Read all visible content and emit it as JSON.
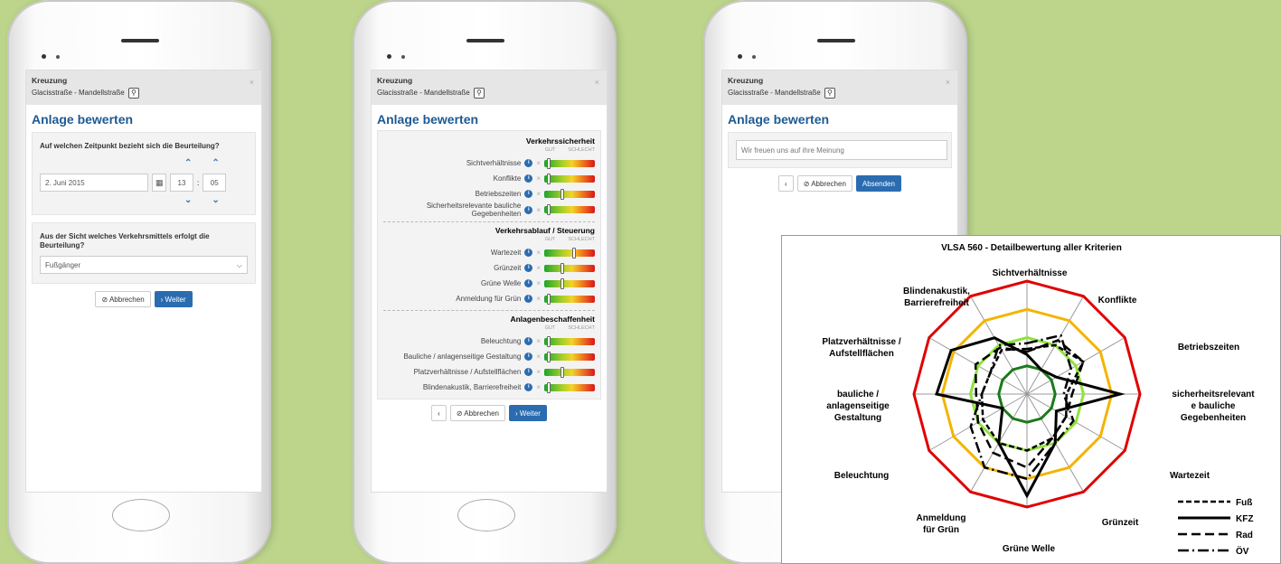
{
  "header": {
    "title": "Kreuzung",
    "address": "Glacisstraße - Mandellstraße",
    "close": "×",
    "pin": "⚲"
  },
  "page_title": "Anlage bewerten",
  "phone1": {
    "question1": "Auf welchen Zeitpunkt bezieht sich die Beurteilung?",
    "date": "2. Juni 2015",
    "hour": "13",
    "minute": "05",
    "question2": "Aus der Sicht welches Verkehrsmittels erfolgt die Beurteilung?",
    "mode": "Fußgänger",
    "cancel": "Abbrechen",
    "next": "Weiter"
  },
  "phone2": {
    "good": "GUT",
    "bad": "SCHLECHT",
    "sections": [
      {
        "title": "Verkehrssicherheit",
        "items": [
          {
            "label": "Sichtverhältnisse",
            "value": 0.05
          },
          {
            "label": "Konflikte",
            "value": 0.05
          },
          {
            "label": "Betriebszeiten",
            "value": 0.35
          },
          {
            "label": "Sicherheitsrelevante bauliche Gegebenheiten",
            "value": 0.05
          }
        ]
      },
      {
        "title": "Verkehrsablauf / Steuerung",
        "items": [
          {
            "label": "Wartezeit",
            "value": 0.6
          },
          {
            "label": "Grünzeit",
            "value": 0.35
          },
          {
            "label": "Grüne Welle",
            "value": 0.35
          },
          {
            "label": "Anmeldung für Grün",
            "value": 0.05
          }
        ]
      },
      {
        "title": "Anlagenbeschaffenheit",
        "items": [
          {
            "label": "Beleuchtung",
            "value": 0.05
          },
          {
            "label": "Bauliche / anlagenseitige Gestaltung",
            "value": 0.05
          },
          {
            "label": "Platzverhältnisse / Aufstellflächen",
            "value": 0.35
          },
          {
            "label": "Blindenakustik, Barrierefreiheit",
            "value": 0.05
          }
        ]
      }
    ],
    "cancel": "Abbrechen",
    "next": "Weiter"
  },
  "phone3": {
    "placeholder": "Wir freuen uns auf ihre Meinung",
    "cancel": "Abbrechen",
    "submit": "Absenden"
  },
  "chart_data": {
    "type": "radar",
    "title": "VLSA 560 - Detailbewertung aller Kriterien",
    "axes": [
      "Sichtverhältnisse",
      "Konflikte",
      "Betriebszeiten",
      "sicherheitsrelevante bauliche Gegebenheiten",
      "Wartezeit",
      "Grünzeit",
      "Grüne Welle",
      "Anmeldung für Grün",
      "Beleuchtung",
      "bauliche / anlagenseitige Gestaltung",
      "Platzverhältnisse / Aufstellflächen",
      "Blindenakustik, Barrierefreiheit"
    ],
    "axis_labels": [
      "Sichtverhältnisse",
      "Konflikte",
      "Betriebszeiten",
      "sicherheitsrelevant|e bauliche|Gegebenheiten",
      "Wartezeit",
      "Grünzeit",
      "Grüne Welle",
      "Anmeldung|für Grün",
      "Beleuchtung",
      "bauliche /|anlagenseitige|Gestaltung",
      "Platzverhältnisse /|Aufstellflächen",
      "Blindenakustik,|Barrierefreiheit"
    ],
    "rings": [
      {
        "level": 1,
        "color": "#1a7a1a"
      },
      {
        "level": 2,
        "color": "#8fe33a"
      },
      {
        "level": 3,
        "color": "#f4b400"
      },
      {
        "level": 4,
        "color": "#e00000"
      }
    ],
    "rmax": 4,
    "series": [
      {
        "name": "Fuß",
        "values": [
          1.6,
          2.0,
          2.3,
          1.4,
          1.6,
          1.8,
          2.0,
          2.0,
          1.8,
          1.6,
          1.5,
          1.8
        ]
      },
      {
        "name": "KFZ",
        "values": [
          1.4,
          1.0,
          1.2,
          3.3,
          1.2,
          2.0,
          3.6,
          2.0,
          1.0,
          3.2,
          3.1,
          2.3
        ]
      },
      {
        "name": "Rad",
        "values": [
          1.5,
          2.2,
          2.3,
          1.6,
          1.6,
          1.8,
          2.6,
          2.4,
          2.0,
          1.8,
          2.1,
          1.9
        ]
      },
      {
        "name": "ÖV",
        "values": [
          1.8,
          2.4,
          1.8,
          1.3,
          1.9,
          2.0,
          3.0,
          3.0,
          2.3,
          1.6,
          1.5,
          2.0
        ]
      }
    ]
  }
}
